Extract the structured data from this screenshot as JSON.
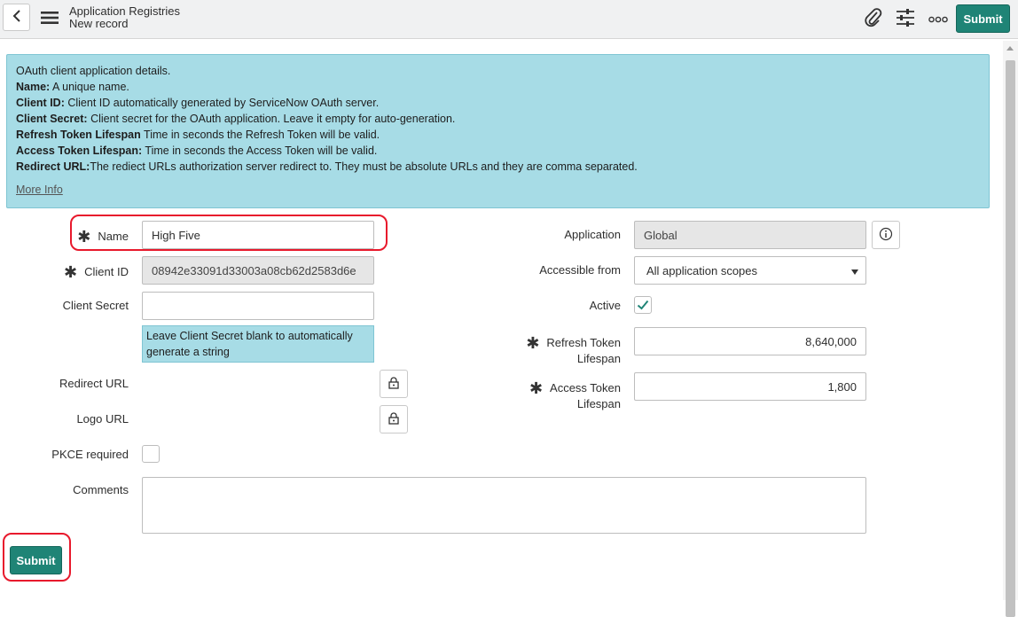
{
  "header": {
    "title": "Application Registries",
    "subtitle": "New record",
    "submit_label": "Submit"
  },
  "icons": {
    "back": "chevron-left-icon",
    "menu": "hamburger-menu-icon",
    "attach": "paperclip-icon",
    "personalize": "sliders-icon",
    "more": "more-options-icon",
    "lock": "lock-icon",
    "info": "info-icon",
    "check": "checkmark-icon"
  },
  "info": {
    "intro": "OAuth client application details.",
    "lines": [
      {
        "term": "Name:",
        "text": " A unique name."
      },
      {
        "term": "Client ID:",
        "text": " Client ID automatically generated by ServiceNow OAuth server."
      },
      {
        "term": "Client Secret:",
        "text": " Client secret for the OAuth application. Leave it empty for auto-generation."
      },
      {
        "term": "Refresh Token Lifespan",
        "text": " Time in seconds the Refresh Token will be valid."
      },
      {
        "term": "Access Token Lifespan:",
        "text": " Time in seconds the Access Token will be valid."
      },
      {
        "term": "Redirect URL:",
        "text": "The rediect URLs authorization server redirect to. They must be absolute URLs and they are comma separated."
      }
    ],
    "more_info": "More Info"
  },
  "form": {
    "name": {
      "label": "Name",
      "value": "High Five"
    },
    "client_id": {
      "label": "Client ID",
      "value": "08942e33091d33003a08cb62d2583d6e"
    },
    "client_secret": {
      "label": "Client Secret",
      "value": "",
      "hint": "Leave Client Secret blank to automatically generate a string"
    },
    "redirect_url": {
      "label": "Redirect URL"
    },
    "logo_url": {
      "label": "Logo URL"
    },
    "pkce_required": {
      "label": "PKCE required",
      "checked": false
    },
    "comments": {
      "label": "Comments",
      "value": ""
    },
    "application": {
      "label": "Application",
      "value": "Global"
    },
    "accessible_from": {
      "label": "Accessible from",
      "value": "All application scopes"
    },
    "active": {
      "label": "Active",
      "checked": true
    },
    "refresh_token_lifespan": {
      "label_1": "Refresh Token",
      "label_2": "Lifespan",
      "value": "8,640,000"
    },
    "access_token_lifespan": {
      "label_1": "Access Token",
      "label_2": "Lifespan",
      "value": "1,800"
    }
  },
  "footer": {
    "submit_label": "Submit"
  },
  "colors": {
    "accent": "#1f8476",
    "info_bg": "#a7dce6",
    "highlight": "#e8192c"
  }
}
